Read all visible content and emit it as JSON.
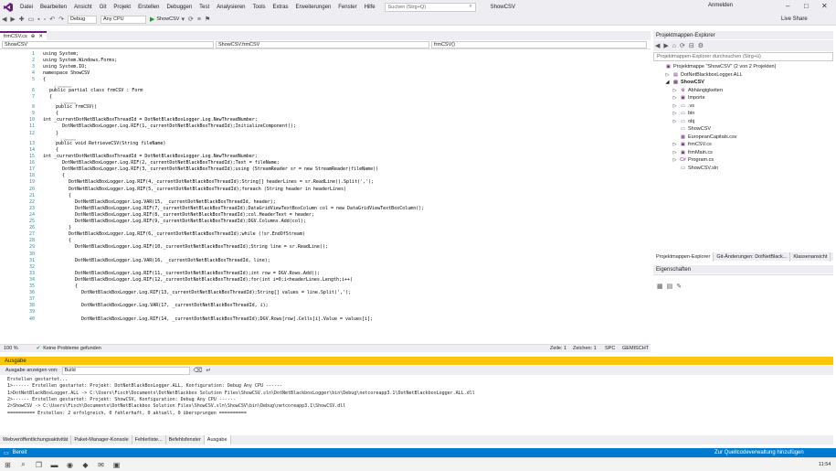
{
  "title_bar": {
    "menu": [
      "Datei",
      "Bearbeiten",
      "Ansicht",
      "Git",
      "Projekt",
      "Erstellen",
      "Debuggen",
      "Test",
      "Analysieren",
      "Tools",
      "Extras",
      "Erweiterungen",
      "Fenster",
      "Hilfe"
    ],
    "search_placeholder": "Suchen (Strg+Q)",
    "solution_name": "ShowCSV",
    "sign_in": "Anmelden"
  },
  "toolbar": {
    "config": "Debug",
    "platform": "Any CPU",
    "start": "ShowCSV",
    "live_share": "Live Share"
  },
  "editor": {
    "tab": "frmCSV.cs",
    "nav_project": "ShowCSV",
    "nav_class": "ShowCSV.frmCSV",
    "nav_member": "frmCSV()",
    "zoom": "100 %",
    "problems": "Keine Probleme gefunden",
    "line": "Zeile: 1",
    "col": "Zeichen: 1",
    "spc": "SPC",
    "enc": "GEMISCHT"
  },
  "code_lines": [
    {
      "n": "1",
      "t": "using System;",
      "x": 0
    },
    {
      "n": "2",
      "t": "using System.Windows.Forms;",
      "x": 0
    },
    {
      "n": "3",
      "t": "using System.IO;",
      "x": 0
    },
    {
      "n": "4",
      "t": "namespace ShowCSV",
      "x": 0
    },
    {
      "n": "5",
      "t": "{",
      "x": 0
    },
    {
      "n": "6",
      "t": "public partial class frmCSV : Form",
      "x": 1,
      "hint": "4 Verweise"
    },
    {
      "n": "7",
      "t": "{",
      "x": 1
    },
    {
      "n": "8",
      "t": "public frmCSV()",
      "x": 2,
      "hint": "1 Verweis"
    },
    {
      "n": "9",
      "t": "{",
      "x": 2
    },
    {
      "n": "10",
      "t": "int _currentDotNetBlackBoxThreadId = DotNetBlackBoxLogger.Log.NewThreadNumber;",
      "x": 0
    },
    {
      "n": "11",
      "t": "DotNetBlackBoxLogger.Log.RIF(1,_currentDotNetBlackBoxThreadId);InitializeComponent();",
      "x": 3
    },
    {
      "n": "12",
      "t": "}",
      "x": 2
    },
    {
      "n": "13",
      "t": "public void RetrieveCSV(String fileName)",
      "x": 2,
      "hint": "1 Verweis"
    },
    {
      "n": "14",
      "t": "{",
      "x": 2
    },
    {
      "n": "15",
      "t": "int _currentDotNetBlackBoxThreadId = DotNetBlackBoxLogger.Log.NewThreadNumber;",
      "x": 0
    },
    {
      "n": "16",
      "t": "DotNetBlackBoxLogger.Log.RIF(2,_currentDotNetBlackBoxThreadId);Text = fileName;",
      "x": 3
    },
    {
      "n": "17",
      "t": "DotNetBlackBoxLogger.Log.RIF(3,_currentDotNetBlackBoxThreadId);using (StreamReader sr = new StreamReader(fileName))",
      "x": 3
    },
    {
      "n": "18",
      "t": "{",
      "x": 3
    },
    {
      "n": "19",
      "t": "DotNetBlackBoxLogger.Log.RIF(4,_currentDotNetBlackBoxThreadId);String[] headerLines = sr.ReadLine().Split(',');",
      "x": 4
    },
    {
      "n": "20",
      "t": "DotNetBlackBoxLogger.Log.RIF(5,_currentDotNetBlackBoxThreadId);foreach (String header in headerLines)",
      "x": 4
    },
    {
      "n": "21",
      "t": "{",
      "x": 4
    },
    {
      "n": "22",
      "t": "DotNetBlackBoxLogger.Log.VAR(15, _currentDotNetBlackBoxThreadId, header);",
      "x": 5
    },
    {
      "n": "23",
      "t": "DotNetBlackBoxLogger.Log.RIF(7,_currentDotNetBlackBoxThreadId);DataGridViewTextBoxColumn col = new DataGridViewTextBoxColumn();",
      "x": 5
    },
    {
      "n": "24",
      "t": "DotNetBlackBoxLogger.Log.RIF(8,_currentDotNetBlackBoxThreadId);col.HeaderText = header;",
      "x": 5
    },
    {
      "n": "25",
      "t": "DotNetBlackBoxLogger.Log.RIF(9,_currentDotNetBlackBoxThreadId);DGV.Columns.Add(col);",
      "x": 5
    },
    {
      "n": "26",
      "t": "}",
      "x": 4
    },
    {
      "n": "27",
      "t": "DotNetBlackBoxLogger.Log.RIF(6,_currentDotNetBlackBoxThreadId);while (!sr.EndOfStream)",
      "x": 4
    },
    {
      "n": "28",
      "t": "{",
      "x": 4
    },
    {
      "n": "29",
      "t": "DotNetBlackBoxLogger.Log.RIF(10,_currentDotNetBlackBoxThreadId);String line = sr.ReadLine();",
      "x": 5
    },
    {
      "n": "30",
      "t": "",
      "x": 5
    },
    {
      "n": "31",
      "t": "DotNetBlackBoxLogger.Log.VAR(16, _currentDotNetBlackBoxThreadId, line);",
      "x": 5
    },
    {
      "n": "32",
      "t": "",
      "x": 5
    },
    {
      "n": "33",
      "t": "DotNetBlackBoxLogger.Log.RIF(11,_currentDotNetBlackBoxThreadId);int row = DGV.Rows.Add();",
      "x": 5
    },
    {
      "n": "34",
      "t": "DotNetBlackBoxLogger.Log.RIF(12,_currentDotNetBlackBoxThreadId);for(int i=0;i<headerLines.Length;i++)",
      "x": 5
    },
    {
      "n": "35",
      "t": "{",
      "x": 5
    },
    {
      "n": "36",
      "t": "DotNetBlackBoxLogger.Log.RIF(13,_currentDotNetBlackBoxThreadId);String[] values = line.Split(',');",
      "x": 6
    },
    {
      "n": "37",
      "t": "",
      "x": 6
    },
    {
      "n": "38",
      "t": "DotNetBlackBoxLogger.Log.VAR(17, _currentDotNetBlackBoxThreadId, i);",
      "x": 6
    },
    {
      "n": "39",
      "t": "",
      "x": 6
    },
    {
      "n": "40",
      "t": "DotNetBlackBoxLogger.Log.RIF(14, _currentDotNetBlackBoxThreadId);DGV.Rows[row].Cells[i].Value = values[i];",
      "x": 6
    }
  ],
  "output": {
    "header": "Ausgabe",
    "show_from_label": "Ausgabe anzeigen von:",
    "source": "Build",
    "lines": [
      "Erstellen gestartet...",
      "1>------ Erstellen gestartet: Projekt: DotNetBlackBoxLogger.ALL, Konfiguration: Debug Any CPU ------",
      "1>DotNetBlackBoxLogger.ALL -> C:\\Users\\Fisch\\Documents\\DotNetBlackbox Solution Files\\ShowCSV.sln\\DotNetBlackboxLogger\\bin\\Debug\\netcoreapp3.1\\DotNetBlackboxLogger.ALL.dll",
      "2>------ Erstellen gestartet: Projekt: ShowCSV, Konfiguration: Debug Any CPU ------",
      "2>ShowCSV -> C:\\Users\\Fisch\\Documents\\DotNetBlackbox Solution Files\\ShowCSV.sln\\ShowCSV\\bin\\Debug\\netcoreapp3.1\\ShowCSV.dll",
      "========== Erstellen: 2 erfolgreich, 0 fehlerhaft, 0 aktuell, 0 übersprungen =========="
    ]
  },
  "bottom_tabs": [
    "Webveröffentlichungsaktivität",
    "Paket-Manager-Konsole",
    "Fehlerliste...",
    "Befehlsfenster",
    "Ausgabe"
  ],
  "status": {
    "ready": "Bereit",
    "source_control": "Zur Quellcodeverwaltung hinzufügen",
    "time": "11:54"
  },
  "solution_explorer": {
    "title": "Projektmappen-Explorer",
    "search": "Projektmappen-Explorer durchsuchen (Strg+ü)",
    "items": [
      {
        "label": "Projektmappe \"ShowCSV\" (2 von 2 Projekten)",
        "level": 0,
        "icon": "▣"
      },
      {
        "label": "DotNetBlackboxLogger.ALL",
        "level": 1,
        "icon": "▤",
        "exp": "▷"
      },
      {
        "label": "ShowCSV",
        "level": 1,
        "icon": "▤",
        "exp": "◢",
        "bold": true
      },
      {
        "label": "Abhängigkeiten",
        "level": 2,
        "icon": "⚙",
        "exp": "▷"
      },
      {
        "label": "Importe",
        "level": 2,
        "icon": "▣",
        "exp": "▷"
      },
      {
        "label": ".vs",
        "level": 2,
        "icon": "▭",
        "exp": "▷"
      },
      {
        "label": "bin",
        "level": 2,
        "icon": "▭",
        "exp": "▷"
      },
      {
        "label": "obj",
        "level": 2,
        "icon": "▭",
        "exp": "▷"
      },
      {
        "label": "ShowCSV",
        "level": 2,
        "icon": "▭"
      },
      {
        "label": "EuropeanCapitals.csv",
        "level": 2,
        "icon": "▦"
      },
      {
        "label": "frmCSV.cs",
        "level": 2,
        "icon": "▣",
        "exp": "▷"
      },
      {
        "label": "frmMain.cs",
        "level": 2,
        "icon": "▣",
        "exp": "▷"
      },
      {
        "label": "Program.cs",
        "level": 2,
        "icon": "C#",
        "exp": "▷"
      },
      {
        "label": "ShowCSV.sln",
        "level": 2,
        "icon": "▭"
      }
    ]
  },
  "se_tabs": [
    "Projektmappen-Explorer",
    "Git-Änderungen: DotNetBlack...",
    "Klassenansicht"
  ],
  "properties": {
    "title": "Eigenschaften"
  }
}
